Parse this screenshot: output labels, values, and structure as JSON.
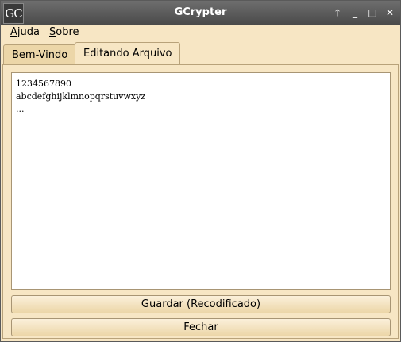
{
  "window": {
    "app_icon_text": "GC",
    "title": "GCrypter",
    "controls": {
      "up": "🡑",
      "minimize": "_",
      "maximize": "□",
      "close": "✕"
    }
  },
  "menubar": {
    "items": [
      {
        "mnemonic": "A",
        "rest": "juda"
      },
      {
        "mnemonic": "S",
        "rest": "obre"
      }
    ]
  },
  "tabs": [
    {
      "label": "Bem-Vindo",
      "active": false
    },
    {
      "label": "Editando Arquivo",
      "active": true
    }
  ],
  "editor": {
    "lines": [
      "1234567890",
      "abcdefghijklmnopqrstuvwxyz",
      "..."
    ]
  },
  "buttons": {
    "save_label": "Guardar (Recodificado)",
    "close_label": "Fechar"
  }
}
